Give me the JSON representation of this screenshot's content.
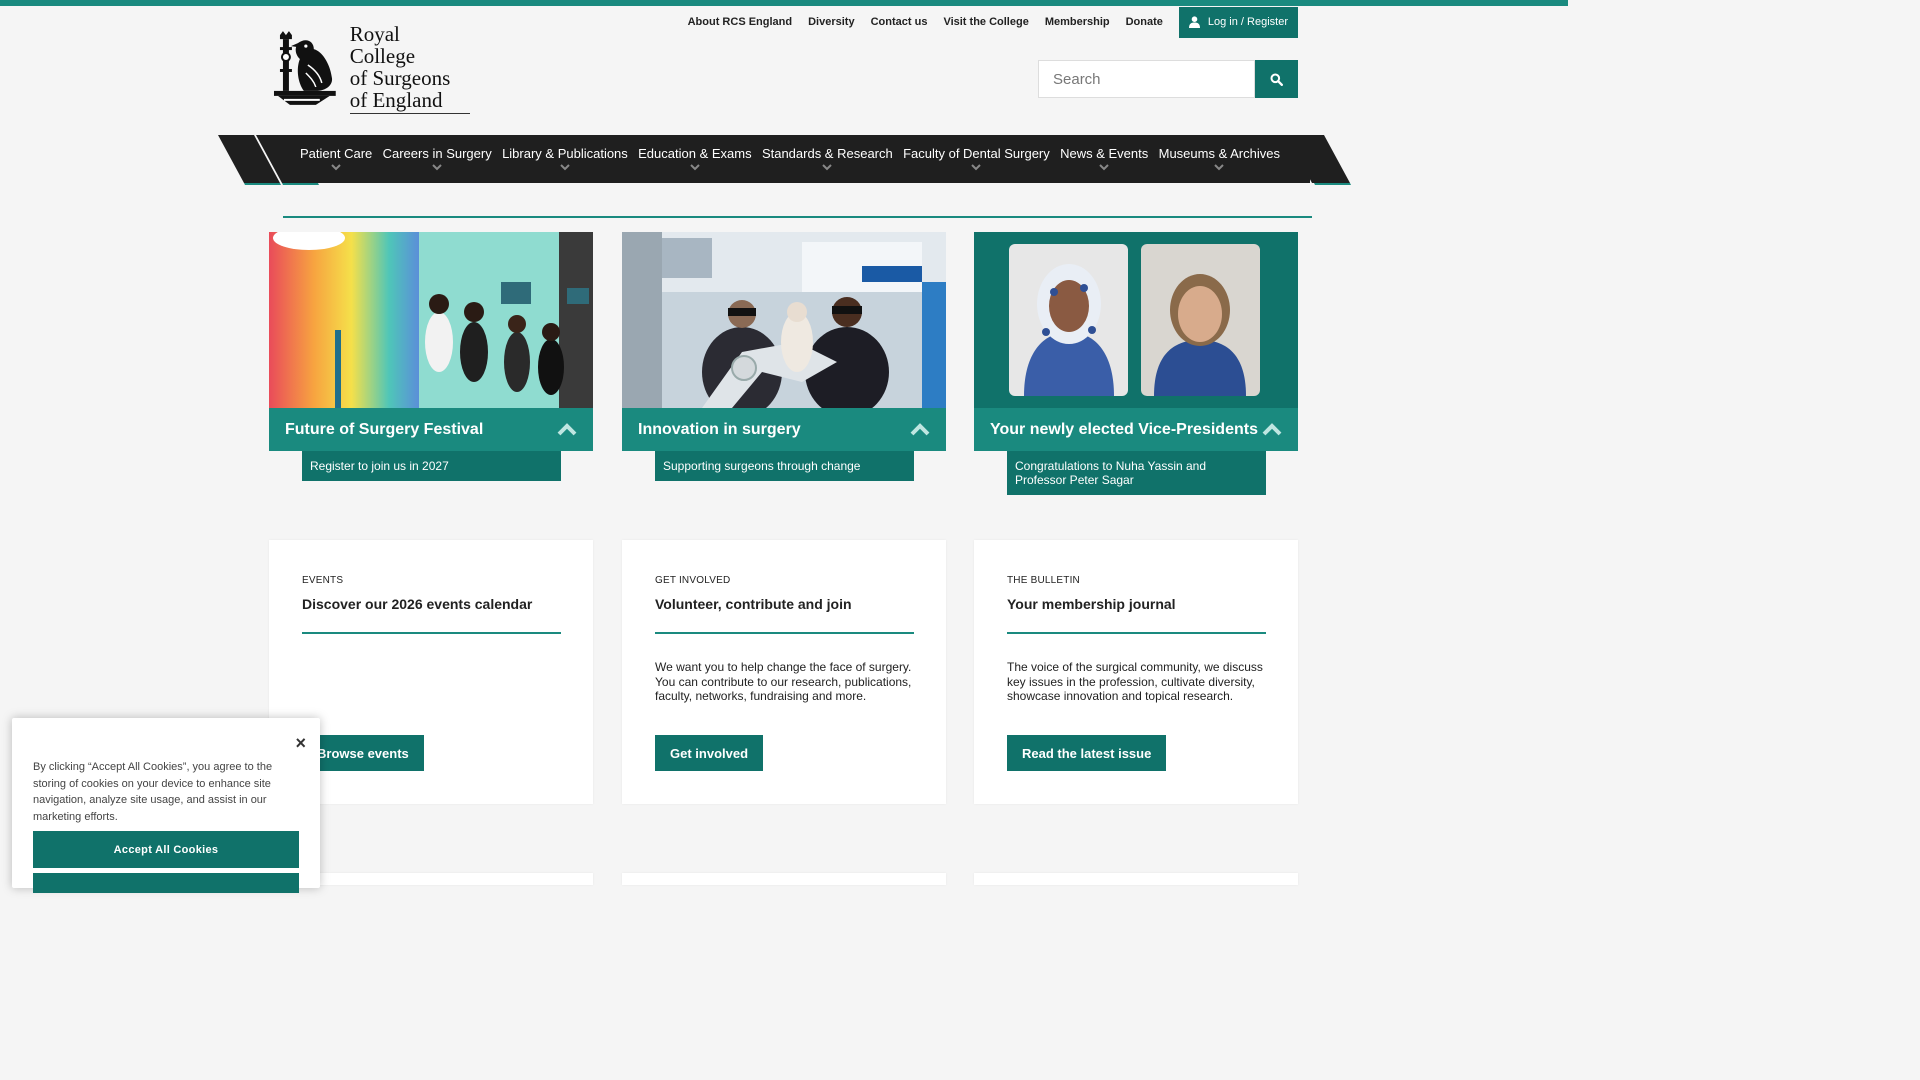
{
  "utility_nav": [
    "About RCS England",
    "Diversity",
    "Contact us",
    "Visit the College",
    "Membership",
    "Donate"
  ],
  "login_label": "Log in / Register",
  "logo": {
    "line1": "Royal College",
    "line2": "of Surgeons",
    "line3": "of England"
  },
  "search": {
    "placeholder": "Search"
  },
  "main_nav": [
    "Patient Care",
    "Careers in Surgery",
    "Library & Publications",
    "Education & Exams",
    "Standards & Research",
    "Faculty of Dental Surgery",
    "News & Events",
    "Museums & Archives"
  ],
  "features": [
    {
      "title": "Future of Surgery Festival",
      "subtitle": "Register to join us in 2027"
    },
    {
      "title": "Innovation in surgery",
      "subtitle": "Supporting surgeons through change"
    },
    {
      "title": "Your newly elected Vice-Presidents",
      "subtitle": "Congratulations to Nuha Yassin and Professor Peter Sagar"
    }
  ],
  "cards": [
    {
      "kicker": "EVENTS",
      "title": "Discover our 2026 events calendar",
      "desc": "",
      "cta": "Browse events"
    },
    {
      "kicker": "GET INVOLVED",
      "title": "Volunteer, contribute and join",
      "desc": "We want you to help change the face of surgery. You can contribute to our research, publications, faculty, networks, fundraising and more.",
      "cta": "Get involved"
    },
    {
      "kicker": "THE BULLETIN",
      "title": "Your membership journal",
      "desc": "The voice of the surgical community, we discuss key issues in the profession, cultivate diversity, showcase innovation and topical research.",
      "cta": "Read the latest issue"
    }
  ],
  "cookie": {
    "message": "By clicking “Accept All Cookies”, you agree to the storing of cookies on your device to enhance site navigation, analyze site usage, and assist in our marketing efforts.",
    "accept": "Accept All Cookies",
    "close": "×"
  },
  "colors": {
    "brand_teal": "#1a8a7f",
    "dark_teal": "#10726a",
    "nav_bg": "#1f1f1f"
  }
}
